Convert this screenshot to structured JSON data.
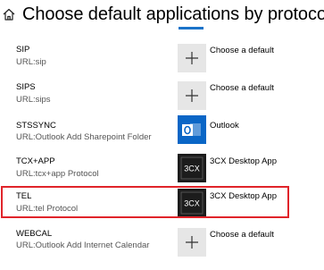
{
  "header": {
    "title": "Choose default applications by protocol",
    "home_icon": "home-icon"
  },
  "protocols": [
    {
      "name": "SIP",
      "description": "URL:sip",
      "app_label": "Choose a default",
      "app_icon": "plus-icon"
    },
    {
      "name": "SIPS",
      "description": "URL:sips",
      "app_label": "Choose a default",
      "app_icon": "plus-icon"
    },
    {
      "name": "STSSYNC",
      "description": "URL:Outlook Add Sharepoint Folder",
      "app_label": "Outlook",
      "app_icon": "outlook-icon"
    },
    {
      "name": "TCX+APP",
      "description": "URL:tcx+app Protocol",
      "app_label": "3CX Desktop App",
      "app_icon": "3cx-icon",
      "icon_text": "3CX"
    },
    {
      "name": "TEL",
      "description": "URL:tel Protocol",
      "app_label": "3CX Desktop App",
      "app_icon": "3cx-icon",
      "icon_text": "3CX"
    },
    {
      "name": "WEBCAL",
      "description": "URL:Outlook Add Internet Calendar",
      "app_label": "Choose a default",
      "app_icon": "plus-icon"
    }
  ],
  "colors": {
    "accent_blue": "#1b73c9",
    "outlook_blue": "#0a66c6",
    "tile_dark": "#1c1c1c",
    "tile_default": "#e6e6e6",
    "highlight_red": "#e0242a"
  }
}
